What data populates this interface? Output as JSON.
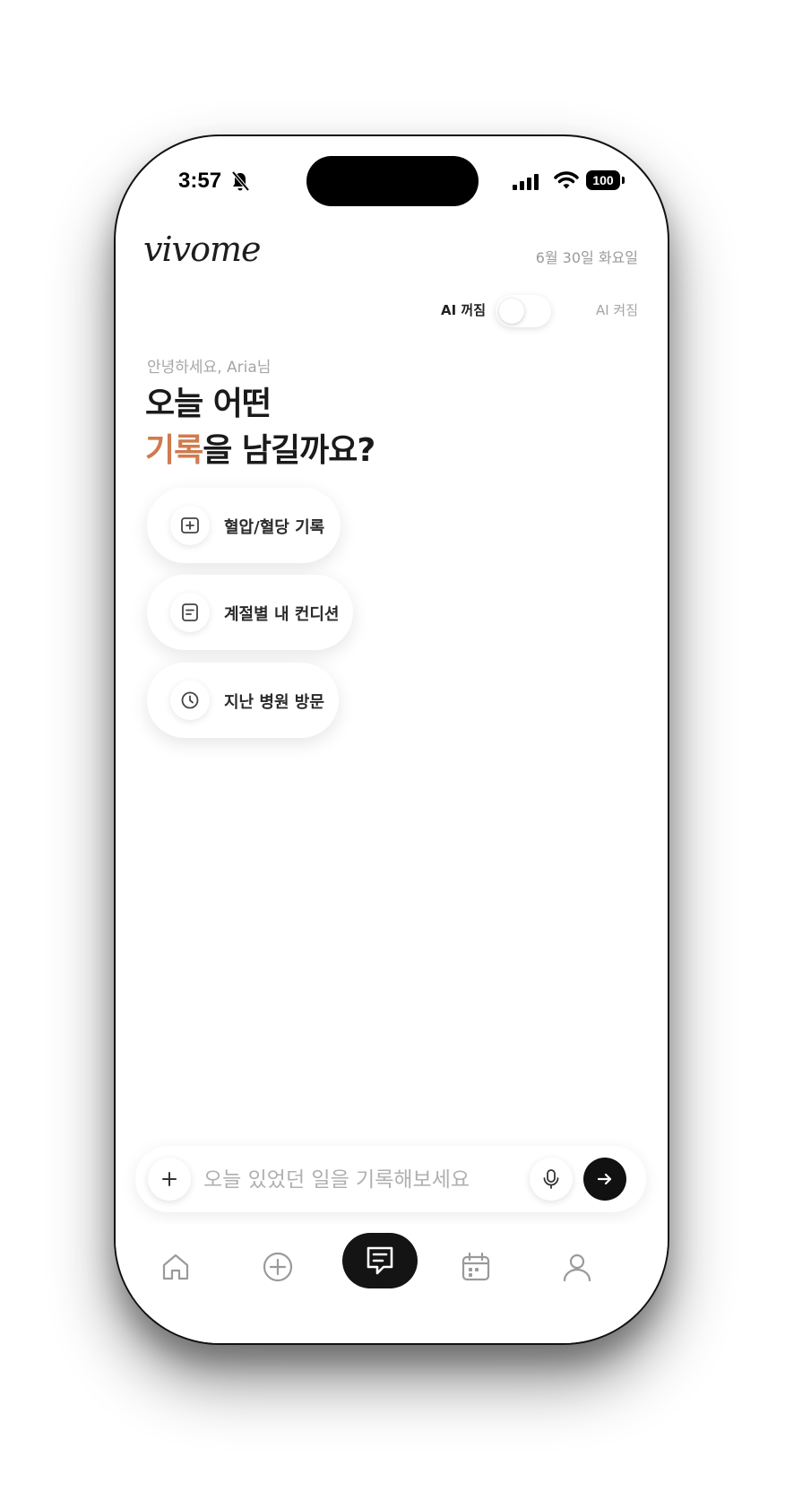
{
  "status_bar": {
    "time": "3:57",
    "battery": "100",
    "icons": [
      "bell-slash-icon",
      "signal-icon",
      "wifi-icon",
      "battery-icon"
    ]
  },
  "header": {
    "logo": "vivome",
    "date": "6월 30일 화요일",
    "ai_off_label": "AI 꺼짐",
    "ai_on_label": "AI 켜짐",
    "ai_enabled": false
  },
  "greeting": {
    "subtitle": "안녕하세요, Aria님",
    "line1": "오늘 어떤",
    "line2_accent": "기록",
    "line2_rest": "을 남길까요?"
  },
  "suggestions": [
    {
      "label": "혈압/혈당 기록",
      "icon": "plus-square-icon"
    },
    {
      "label": "계절별 내 컨디션",
      "icon": "note-icon"
    },
    {
      "label": "지난 병원 방문",
      "icon": "clock-icon"
    }
  ],
  "composer": {
    "placeholder": "오늘 있었던 일을 기록해보세요",
    "value": ""
  },
  "tabs": [
    {
      "name": "home",
      "icon": "home-icon"
    },
    {
      "name": "add",
      "icon": "plus-circle-icon"
    },
    {
      "name": "chat",
      "icon": "chat-icon",
      "active": true
    },
    {
      "name": "calendar",
      "icon": "calendar-icon"
    },
    {
      "name": "profile",
      "icon": "person-icon"
    }
  ],
  "colors": {
    "accent": "#d07b4e",
    "text_primary": "#1a1a1a",
    "text_muted": "#a6a6a6",
    "active_tab": "#141414"
  }
}
